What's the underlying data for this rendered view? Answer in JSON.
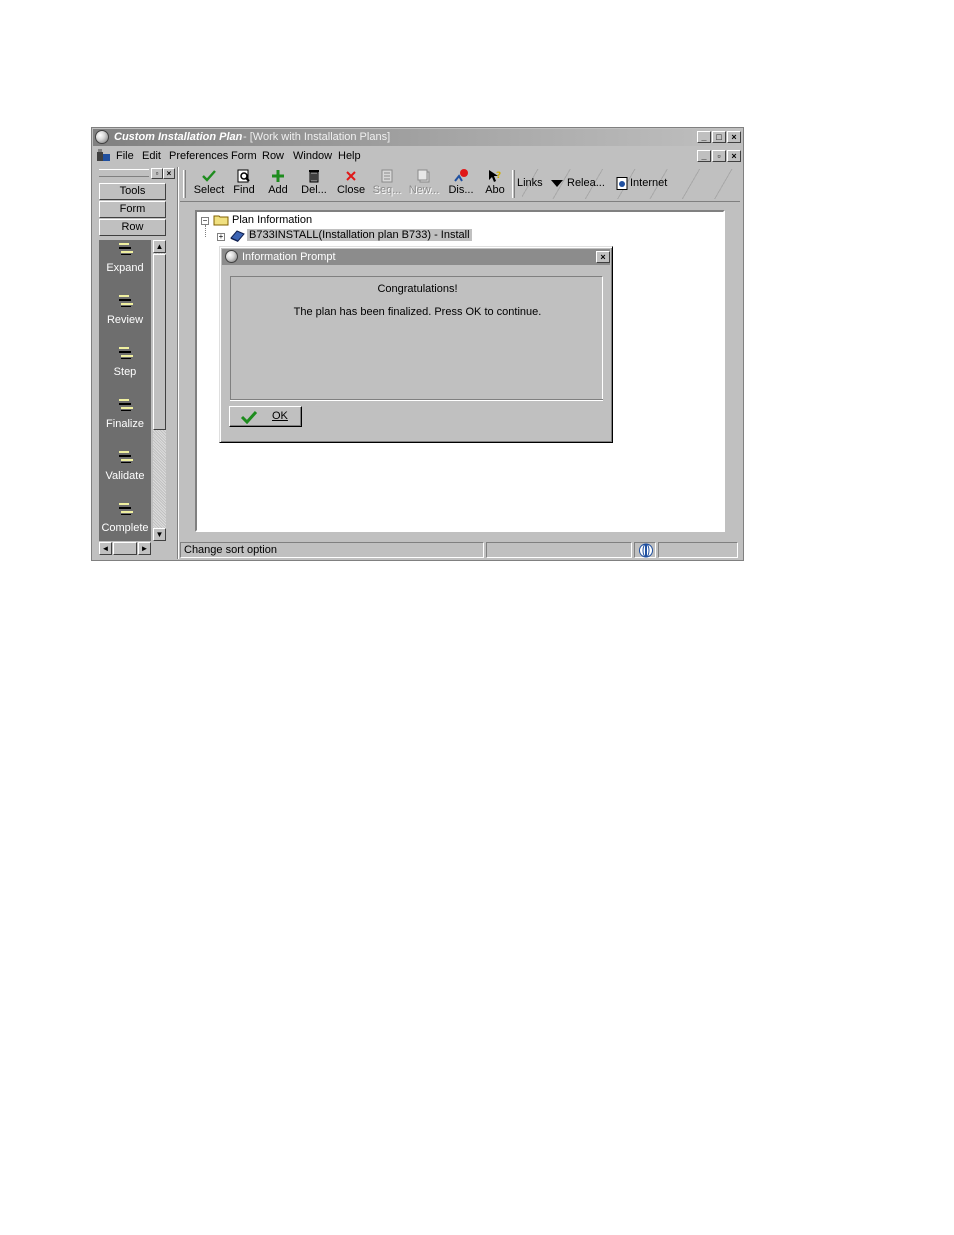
{
  "window": {
    "title_app": "Custom Installation Plan",
    "title_form": "- [Work with Installation Plans]"
  },
  "menu": [
    "File",
    "Edit",
    "Preferences",
    "Form",
    "Row",
    "Window",
    "Help"
  ],
  "left_panel": {
    "tabs": [
      "Tools",
      "Form",
      "Row"
    ],
    "row_exits": [
      "Expand",
      "Review",
      "Step",
      "Finalize",
      "Validate",
      "Complete"
    ]
  },
  "toolbar": {
    "tools": [
      "Select",
      "Find",
      "Add",
      "Del...",
      "Close",
      "Seq...",
      "New...",
      "Dis...",
      "Abo"
    ],
    "links": "Links",
    "relea": "Relea...",
    "internet": "Internet"
  },
  "tree": {
    "root": "Plan Information",
    "child": "B733INSTALL(Installation plan B733) - Install"
  },
  "status": {
    "text": "Change sort option"
  },
  "dialog": {
    "title": "Information Prompt",
    "heading": "Congratulations!",
    "message": "The plan has been finalized.  Press OK to continue.",
    "ok_label": "OK"
  },
  "colors": {
    "title_bar": "#808080",
    "window_face": "#c0c0c0",
    "exit_bar": "#6e6e6e",
    "check_green": "#1e8c1e",
    "close_red": "#e01818"
  }
}
